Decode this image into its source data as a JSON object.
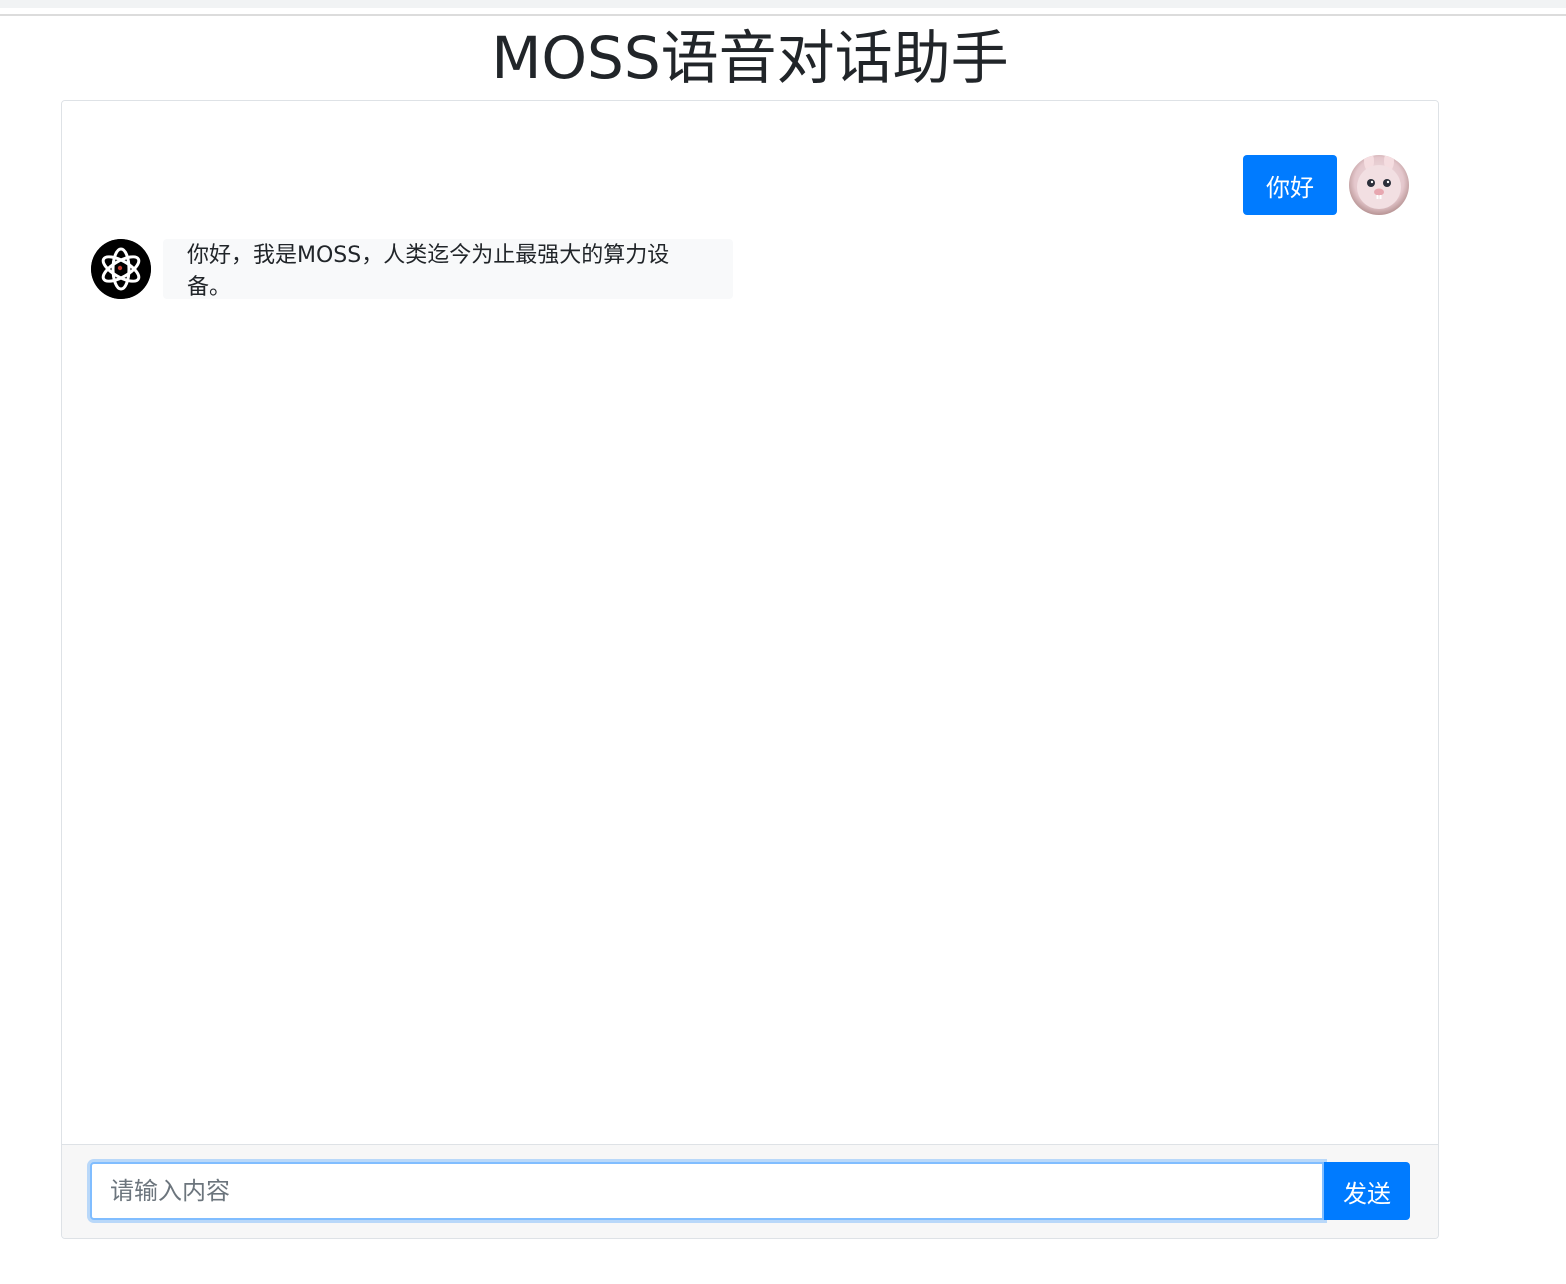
{
  "page": {
    "title": "MOSS语音对话助手"
  },
  "messages": {
    "user": {
      "text": "你好",
      "avatar_icon": "user-avatar-bunny"
    },
    "bot": {
      "text": "你好，我是MOSS，人类迄今为止最强大的算力设备。",
      "avatar_icon": "openai-logo-icon"
    }
  },
  "composer": {
    "input_value": "",
    "input_placeholder": "请输入内容",
    "send_label": "发送"
  },
  "colors": {
    "accent": "#007bff",
    "bot_bubble": "#f8f9fa",
    "footer_bg": "#f7f7f7"
  }
}
